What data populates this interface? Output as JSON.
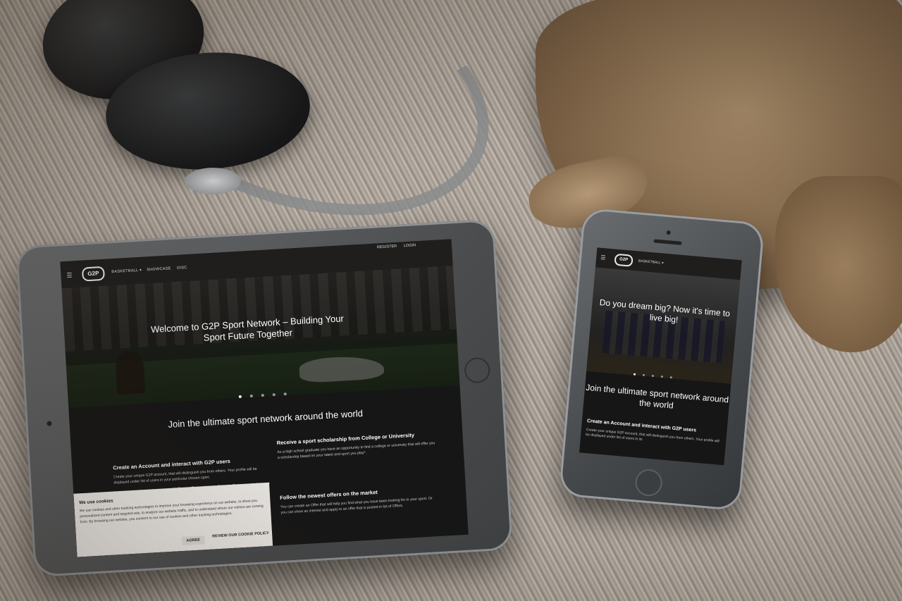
{
  "tablet": {
    "nav": {
      "menu_icon": "hamburger-icon",
      "logo": "G2P",
      "links": [
        "BASKETBALL ▾",
        "SHOWCASE",
        "DISC"
      ],
      "register": "REGISTER",
      "login": "LOGIN"
    },
    "hero": {
      "title": "Welcome to G2P Sport Network – Building Your Sport Future Together",
      "slide_count": 5,
      "active_slide": 1
    },
    "section": {
      "title": "Join the ultimate sport network around the world",
      "features": [
        {
          "title": "Create an Account and interact with G2P users",
          "text": "Create your unique G2P account, that will distinguish you from others. Your profile will be displayed under list of users in your particular chosen sport.",
          "text2": "Increase your chances to connect with Players, Teams, Agents, Schools, Trainers and other way around."
        },
        {
          "title": "Receive a sport scholarship from College or University",
          "text": "As a high school graduate you have an opportunity to find a college or university that will offer you a scholarship based on your talent and sport you play*."
        },
        {
          "title": "Follow the newest offers on the market",
          "text": "You can create an Offer that will help you find what you have been looking for in your sport. Or you can show an interest and apply to an offer that is posted in list of Offers."
        }
      ]
    },
    "cookie": {
      "title": "We use cookies",
      "text": "We use cookies and other tracking technologies to improve your browsing experience on our website, to show you personalized content and targeted ads, to analyze our website traffic, and to understand where our visitors are coming from. By browsing our website, you consent to our use of cookies and other tracking technologies.",
      "agree": "AGREE",
      "policy": "REVIEW OUR COOKIE POLICY"
    }
  },
  "phone": {
    "nav": {
      "menu_icon": "hamburger-icon",
      "logo": "G2P",
      "link": "BASKETBALL ▾"
    },
    "hero": {
      "title": "Do you dream big? Now it's time to live big!"
    },
    "section": {
      "title": "Join the ultimate sport network around the world",
      "feature_title": "Create an Account and interact with G2P users",
      "feature_text": "Create your unique G2P account, that will distinguish you from others. Your profile will be displayed under list of users in its"
    }
  }
}
